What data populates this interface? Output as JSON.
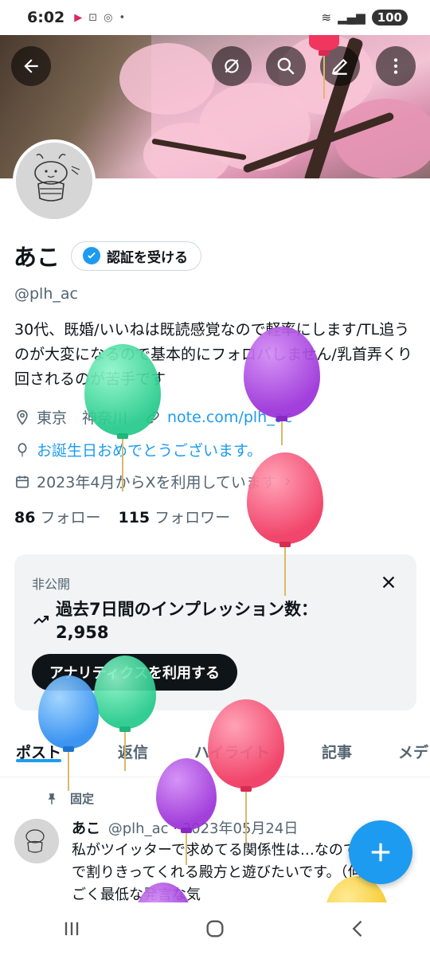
{
  "status_bar": {
    "time": "6:02",
    "battery": "100"
  },
  "profile": {
    "display_name": "あこ",
    "verify_label": "認証を受ける",
    "handle": "@plh_ac",
    "bio": "30代、既婚/いいねは既読感覚なので軽率にします/TL追うのが大変になるので基本的にフォロバしません/乳首弄くり回されるのが苦手です",
    "location": "東京　神奈川",
    "website": "note.com/plh_ac",
    "birthday": "お誕生日おめでとうございます。",
    "joined": "2023年4月からXを利用しています",
    "following_count": "86",
    "following_label": "フォロー",
    "followers_count": "115",
    "followers_label": "フォロワー"
  },
  "analytics_card": {
    "private_label": "非公開",
    "title_line1": "過去7日間のインプレッション数：",
    "title_line2": "2,958",
    "button_label": "アナリティクスを利用する"
  },
  "tabs": [
    {
      "label": "ポスト",
      "active": true
    },
    {
      "label": "返信",
      "active": false
    },
    {
      "label": "ハイライト",
      "active": false
    },
    {
      "label": "記事",
      "active": false
    },
    {
      "label": "メデ",
      "active": false
    }
  ],
  "pinned_post": {
    "pinned_label": "固定",
    "author": "あこ",
    "handle": "@plh_ac",
    "date": "2023年05月24日",
    "text": "私がツイッターで求めてる関係性は…なので、遊びで割りきってくれる殿方と遊びたいです。（何だかすごく最低な発言な気"
  },
  "colors": {
    "accent": "#1d9bf0",
    "text": "#0f1419",
    "muted": "#536471"
  },
  "icons": [
    "back-arrow-icon",
    "sync-off-icon",
    "search-icon",
    "compose-icon",
    "more-icon",
    "verified-badge-icon",
    "location-icon",
    "link-icon",
    "balloon-icon",
    "calendar-icon",
    "chevron-right-icon",
    "close-icon",
    "trending-icon",
    "pin-icon",
    "plus-icon"
  ]
}
